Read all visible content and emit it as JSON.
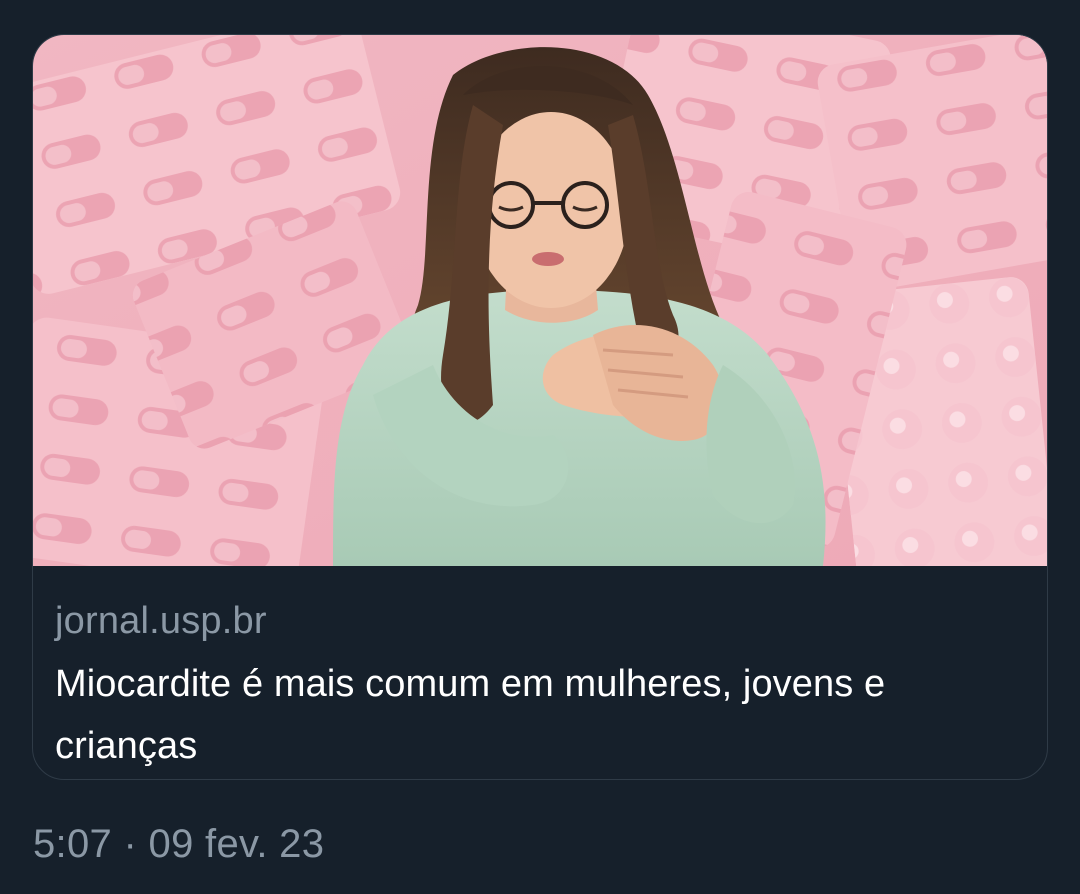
{
  "link_card": {
    "domain": "jornal.usp.br",
    "headline": "Miocardite é mais comum em mulheres, jovens e crianças",
    "image": {
      "subject": "woman-holding-chest-icon",
      "background": "pill-blister-packs-pattern",
      "tint_color": "#f4b8c3",
      "sweater_color": "#b7d6c1",
      "hair_color": "#4a3426"
    }
  },
  "tweet": {
    "time": "5:07",
    "separator": "·",
    "date": "09 fev. 23"
  },
  "colors": {
    "background": "#16202b",
    "card_border": "#2f3b47",
    "muted_text": "#8b98a5",
    "primary_text": "#ffffff"
  }
}
